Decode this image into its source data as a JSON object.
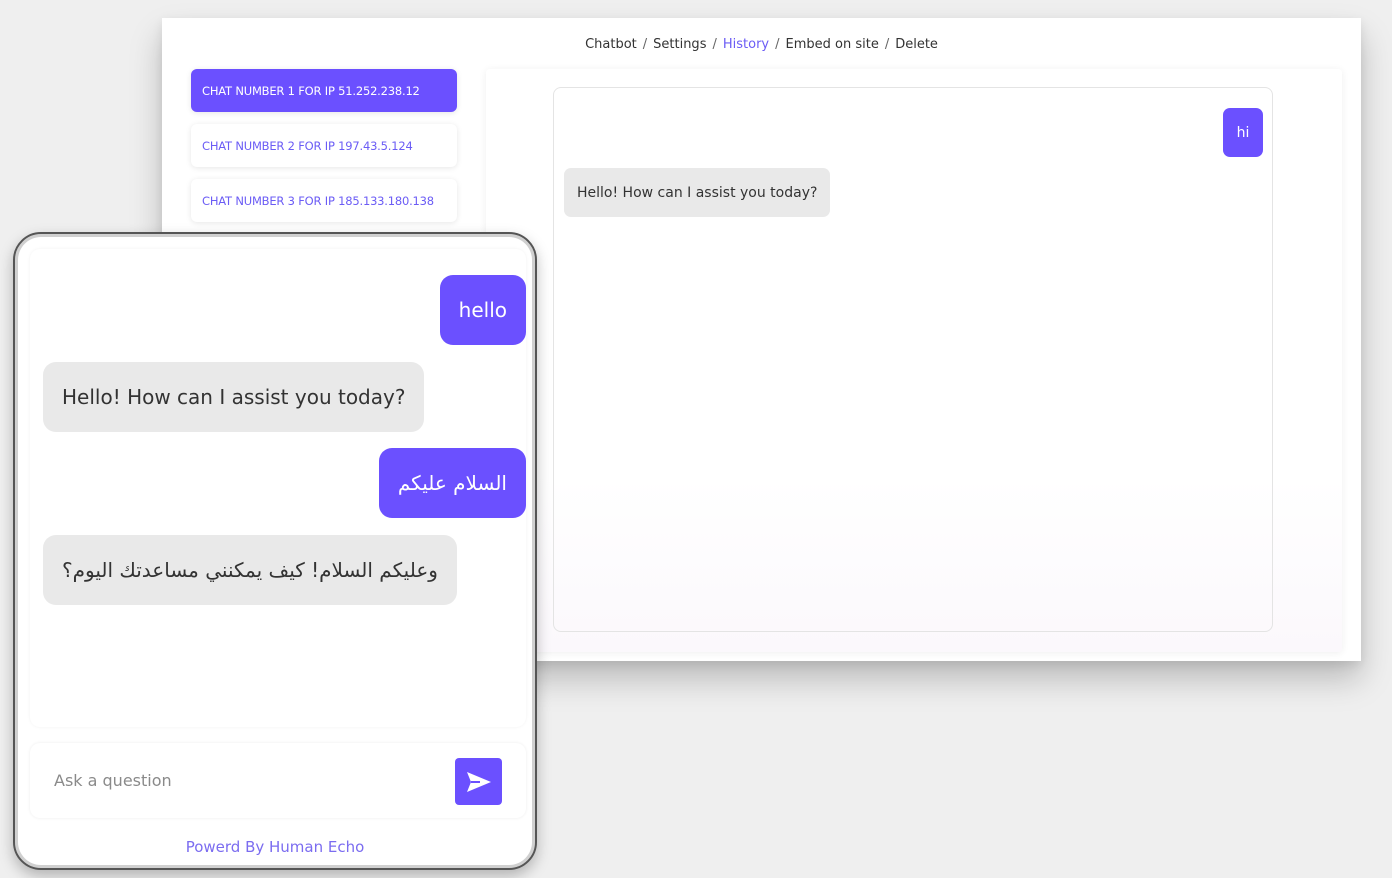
{
  "breadcrumb": {
    "items": [
      "Chatbot",
      "Settings",
      "History",
      "Embed on site",
      "Delete"
    ],
    "active_index": 2,
    "separator": "/"
  },
  "chat_list": [
    {
      "label": "CHAT NUMBER 1 FOR IP 51.252.238.12",
      "selected": true
    },
    {
      "label": "CHAT NUMBER 2 FOR IP 197.43.5.124",
      "selected": false
    },
    {
      "label": "CHAT NUMBER 3 FOR IP 185.133.180.138",
      "selected": false
    }
  ],
  "history_panel": {
    "messages": [
      {
        "role": "user",
        "text": "hi"
      },
      {
        "role": "bot",
        "text": "Hello! How can I assist you today?"
      }
    ]
  },
  "widget": {
    "messages": [
      {
        "role": "user",
        "text": "hello"
      },
      {
        "role": "bot",
        "text": "Hello! How can I assist you today?"
      },
      {
        "role": "user",
        "text": "السلام عليكم"
      },
      {
        "role": "bot",
        "text": "وعليكم السلام! كيف يمكنني مساعدتك اليوم؟"
      }
    ],
    "input": {
      "placeholder": "Ask a question",
      "value": ""
    },
    "send_icon": "send-icon",
    "footer": "Powerd By Human Echo"
  },
  "colors": {
    "accent": "#6b50ff",
    "accent_text": "#6b5cf5",
    "bot_bubble": "#e9e9e9",
    "background": "#efefef"
  }
}
